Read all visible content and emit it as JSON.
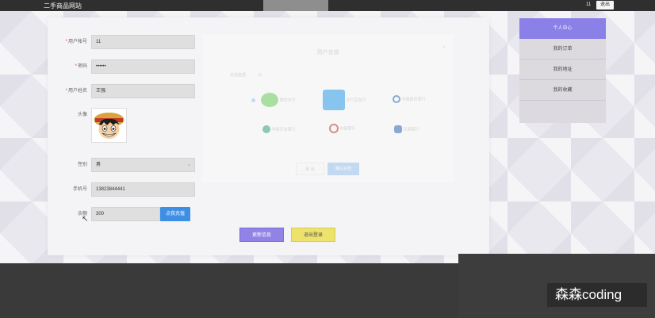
{
  "header": {
    "site_title": "二手商品网站",
    "user": "11",
    "logout": "退出"
  },
  "form": {
    "account_label": "用户帐号",
    "account_value": "11",
    "password_label": "密码",
    "password_value": "••••••",
    "name_label": "用户姓名",
    "name_value": "王强",
    "avatar_label": "头像",
    "gender_label": "性别",
    "gender_value": "男",
    "phone_label": "手机号",
    "phone_value": "13823844441",
    "balance_label": "余额",
    "balance_value": "300",
    "recharge_button": "点我充值",
    "update_button": "更新信息",
    "exit_button": "退出登录"
  },
  "modal": {
    "title": "用户充值",
    "close": "×",
    "amount_label": "充值金额",
    "amount_value": "元",
    "payments": [
      "微信支付",
      "支付宝支付",
      "中国建设银行",
      "中国农业银行",
      "中国银行",
      "交通银行"
    ],
    "cancel": "取 消",
    "confirm": "确认充值"
  },
  "sidebar": {
    "items": [
      {
        "label": "个人中心",
        "active": true
      },
      {
        "label": "我的订单",
        "active": false
      },
      {
        "label": "我的地址",
        "active": false
      },
      {
        "label": "我的收藏",
        "active": false
      }
    ]
  },
  "watermark": "森森coding",
  "colors": {
    "accent": "#8b7fe8",
    "update": "#9182e6",
    "exit": "#ece26c",
    "recharge": "#3e8ee6"
  }
}
